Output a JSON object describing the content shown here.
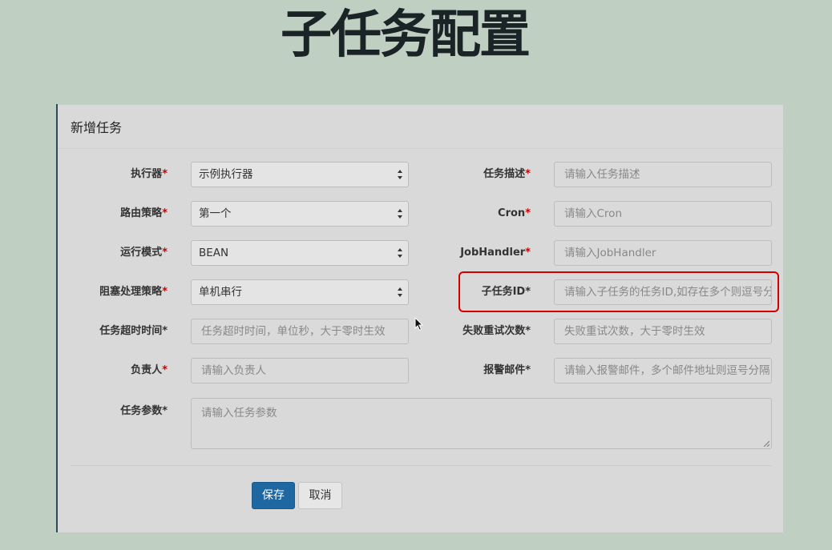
{
  "page": {
    "title": "子任务配置"
  },
  "modal": {
    "title": "新增任务",
    "left_fields": [
      {
        "label": "执行器",
        "required_mark": "*",
        "value": "示例执行器"
      },
      {
        "label": "路由策略",
        "required_mark": "*",
        "value": "第一个"
      },
      {
        "label": "运行模式",
        "required_mark": "*",
        "value": "BEAN"
      },
      {
        "label": "阻塞处理策略",
        "required_mark": "*",
        "value": "单机串行"
      },
      {
        "label": "任务超时时间*",
        "placeholder": "任务超时时间，单位秒，大于零时生效"
      },
      {
        "label": "负责人",
        "required_mark": "*",
        "placeholder": "请输入负责人"
      }
    ],
    "right_fields": [
      {
        "label": "任务描述",
        "required_mark": "*",
        "placeholder": "请输入任务描述"
      },
      {
        "label": "Cron",
        "required_mark": "*",
        "placeholder": "请输入Cron"
      },
      {
        "label": "JobHandler",
        "required_mark": "*",
        "placeholder": "请输入JobHandler"
      },
      {
        "label": "子任务ID*",
        "placeholder": "请输入子任务的任务ID,如存在多个则逗号分隔"
      },
      {
        "label": "失败重试次数*",
        "placeholder": "失败重试次数，大于零时生效"
      },
      {
        "label": "报警邮件*",
        "placeholder": "请输入报警邮件，多个邮件地址则逗号分隔"
      }
    ],
    "params": {
      "label": "任务参数*",
      "placeholder": "请输入任务参数"
    },
    "buttons": {
      "save": "保存",
      "cancel": "取消"
    },
    "highlight_color": "#d40000",
    "primary_color": "#1f67a0"
  }
}
